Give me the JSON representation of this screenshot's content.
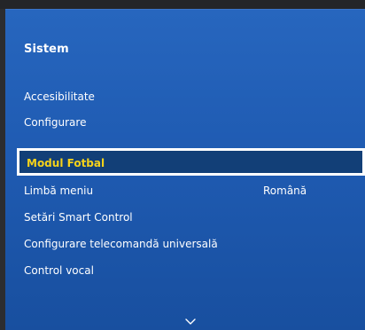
{
  "menu": {
    "title": "Sistem",
    "items": [
      {
        "label": "Accesibilitate"
      },
      {
        "label": "Configurare"
      },
      {
        "label": "Modul Fotbal"
      },
      {
        "label": "Limbă meniu",
        "value": "Română"
      },
      {
        "label": "Setări Smart Control"
      },
      {
        "label": "Configurare telecomandă universală"
      },
      {
        "label": "Control vocal"
      }
    ],
    "selected_index": 2,
    "more_indicator_icon": "chevron-down-icon"
  },
  "colors": {
    "panel": "#1f5bb2",
    "selected_background": "#123f77",
    "selected_text": "#f5d21a",
    "text": "#ffffff",
    "frame": "#2c2d30"
  }
}
